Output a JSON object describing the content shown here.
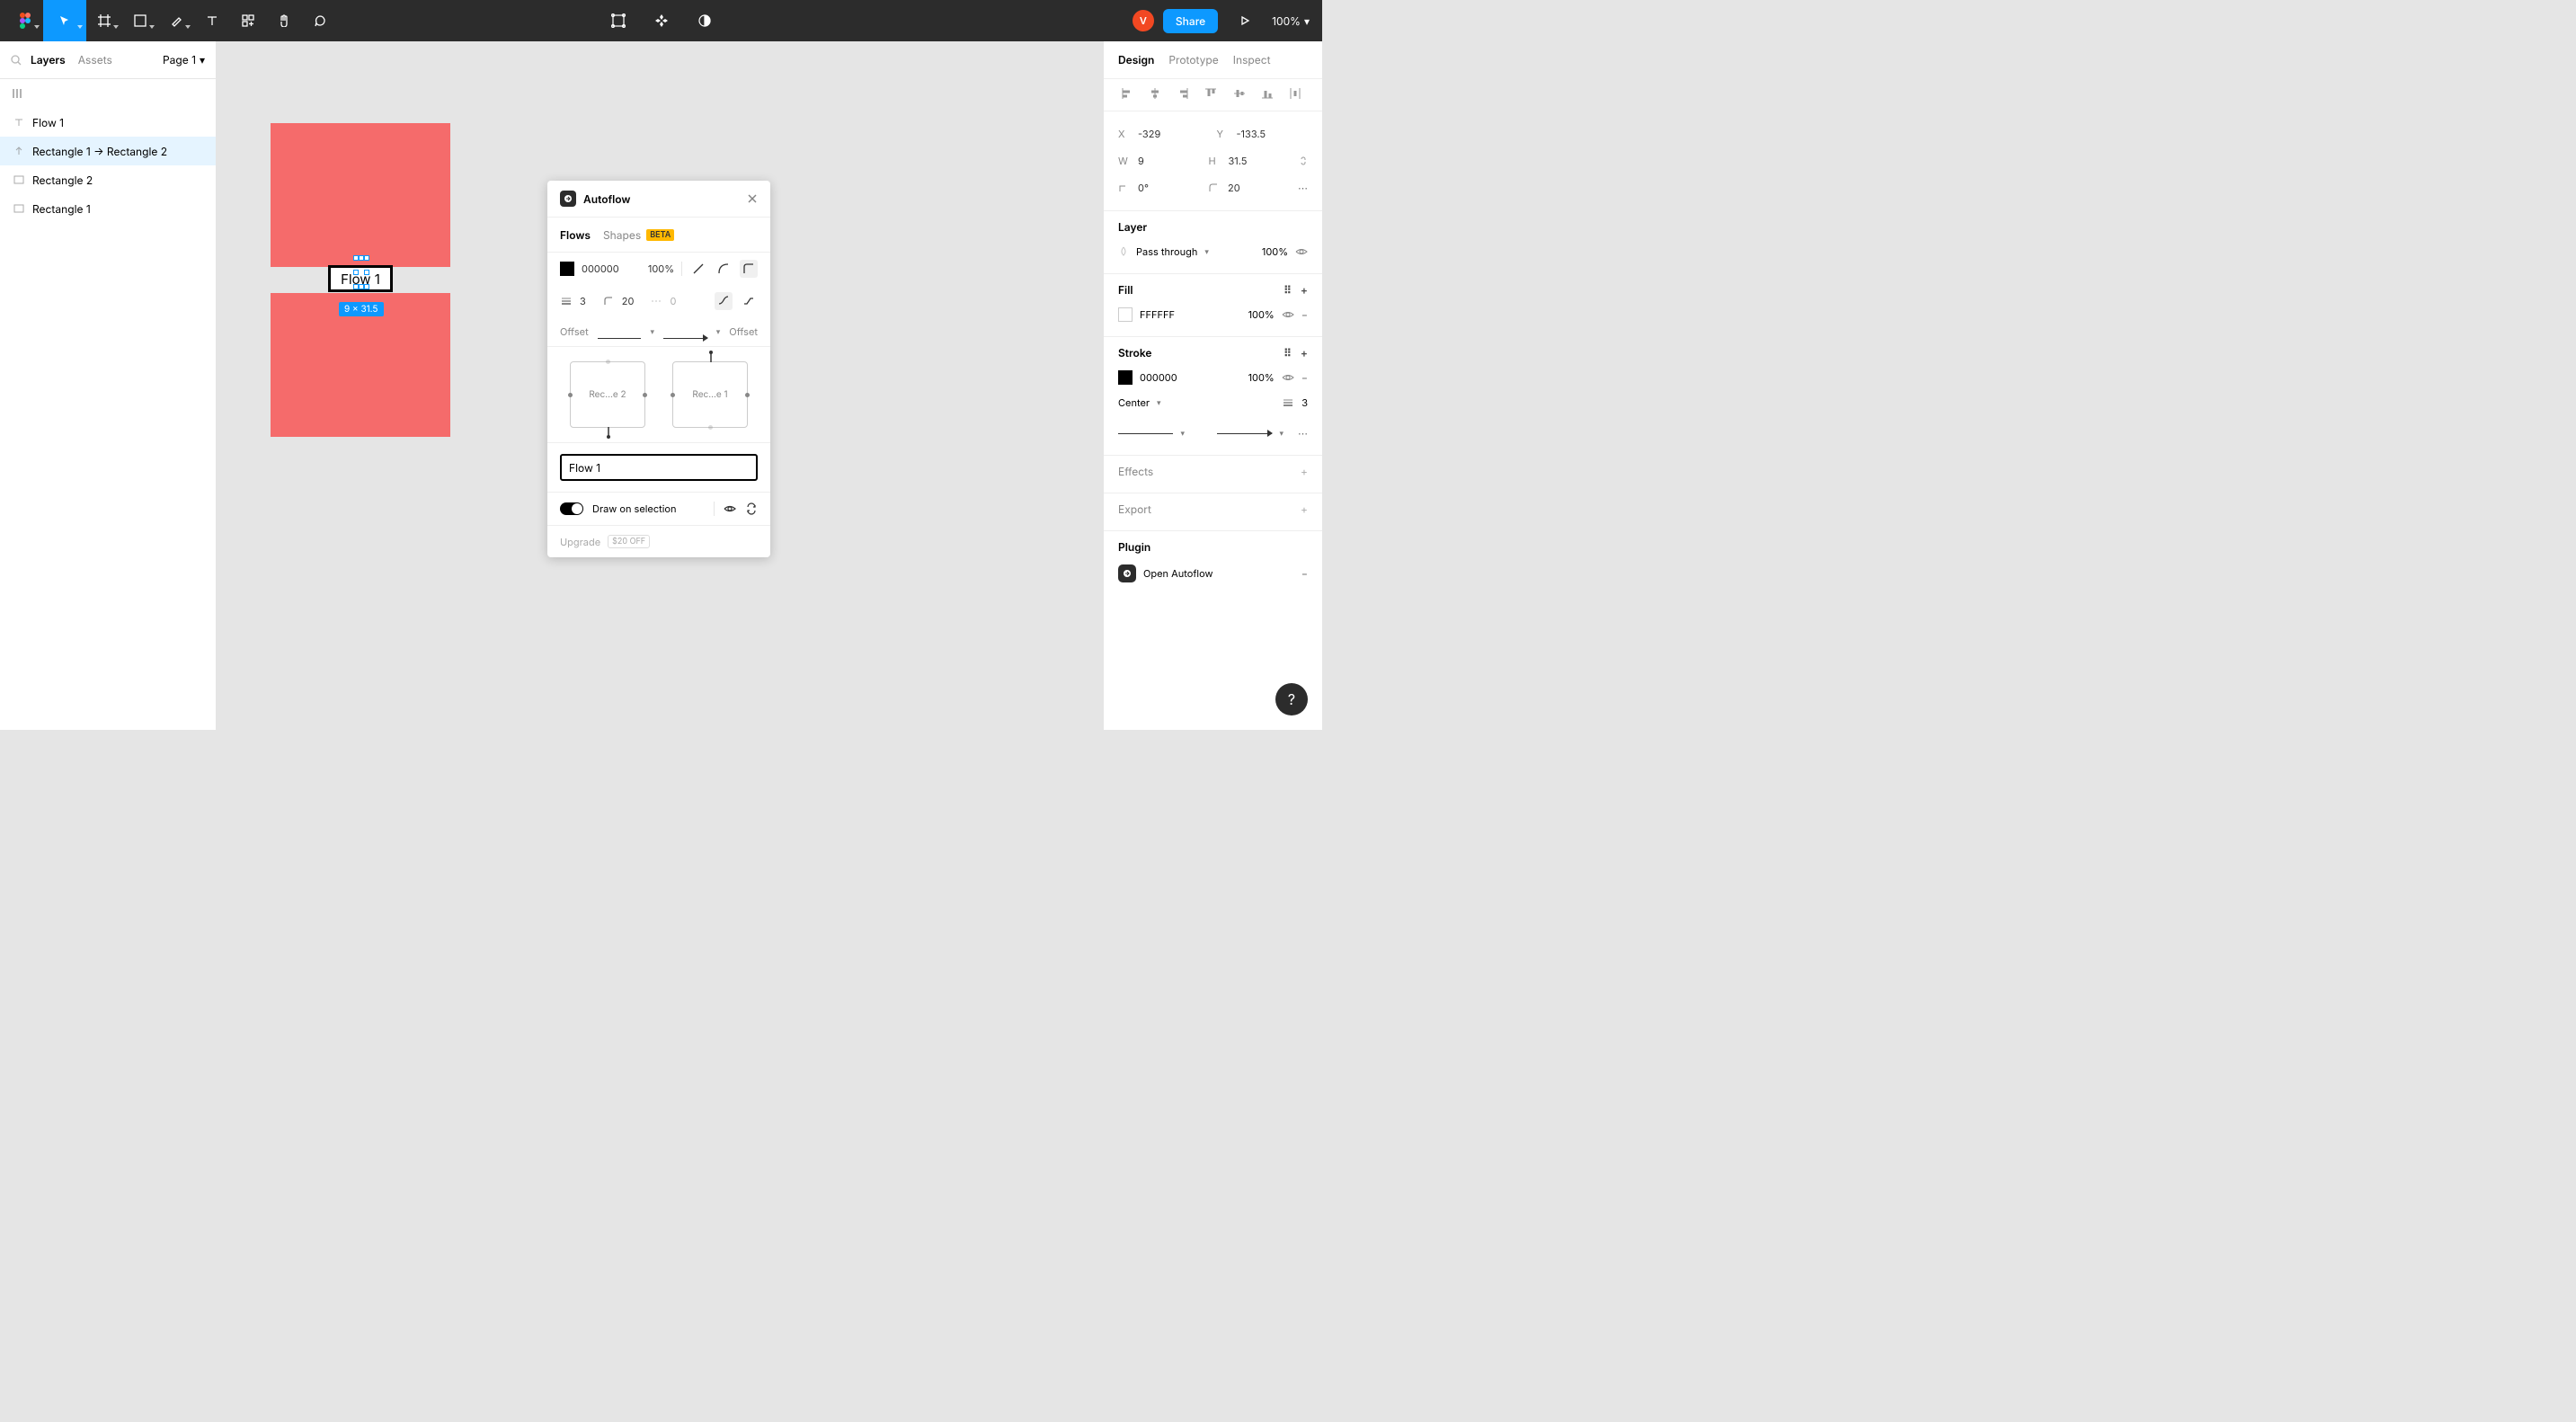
{
  "toolbar": {
    "zoom": "100%",
    "share": "Share",
    "avatar": "V"
  },
  "leftPanel": {
    "tabLayers": "Layers",
    "tabAssets": "Assets",
    "page": "Page 1",
    "layers": [
      {
        "name": "Flow 1",
        "icon": "text"
      },
      {
        "name": "Rectangle 1 → Rectangle 2",
        "icon": "arrow",
        "selected": true
      },
      {
        "name": "Rectangle 2",
        "icon": "rect"
      },
      {
        "name": "Rectangle 1",
        "icon": "rect"
      }
    ]
  },
  "canvas": {
    "flowLabel": "Flow 1",
    "selectionSize": "9 × 31.5"
  },
  "modal": {
    "title": "Autoflow",
    "tabFlows": "Flows",
    "tabShapes": "Shapes",
    "beta": "BETA",
    "strokeColor": "000000",
    "strokeOpacity": "100%",
    "strokeWidth": "3",
    "cornerRadius": "20",
    "dashGap": "0",
    "offsetLeft": "Offset",
    "offsetRight": "Offset",
    "previewA": "Rec…e 2",
    "previewB": "Rec…e 1",
    "flowName": "Flow 1",
    "drawOnSelection": "Draw on selection",
    "upgrade": "Upgrade",
    "upgradeBadge": "$20 OFF"
  },
  "rightPanel": {
    "tabDesign": "Design",
    "tabPrototype": "Prototype",
    "tabInspect": "Inspect",
    "x": "-329",
    "y": "-133.5",
    "w": "9",
    "h": "31.5",
    "rotation": "0°",
    "radius": "20",
    "layerTitle": "Layer",
    "blendMode": "Pass through",
    "layerOpacity": "100%",
    "fillTitle": "Fill",
    "fillColor": "FFFFFF",
    "fillOpacity": "100%",
    "strokeTitle": "Stroke",
    "strokeColor": "000000",
    "strokeOpacity": "100%",
    "strokeAlign": "Center",
    "strokeWidth": "3",
    "effectsTitle": "Effects",
    "exportTitle": "Export",
    "pluginTitle": "Plugin",
    "pluginName": "Open Autoflow"
  }
}
